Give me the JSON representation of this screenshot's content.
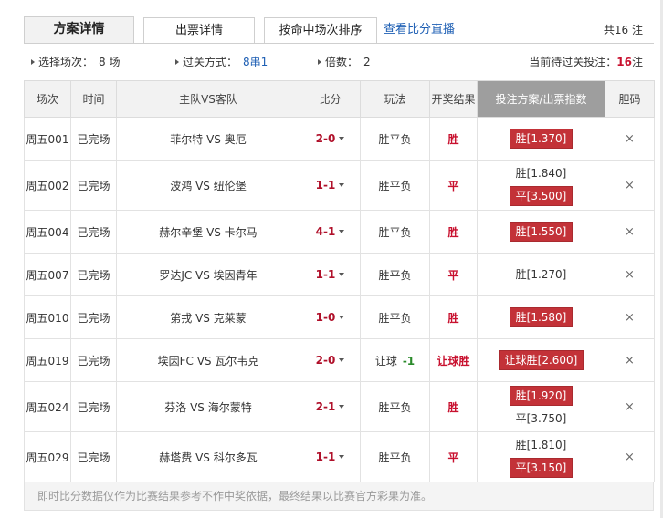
{
  "tabs": {
    "detail": "方案详情",
    "ticket": "出票详情",
    "sort": "按命中场次排序",
    "live_link": "查看比分直播",
    "total": "共16 注"
  },
  "info": {
    "select_label": "选择场次：",
    "select_value": "8 场",
    "pass_label": "过关方式：",
    "pass_value": "8串1",
    "multi_label": "倍数：",
    "multi_value": "2",
    "pending_label": "当前待过关投注：",
    "pending_value": "16",
    "pending_unit": "注"
  },
  "headers": {
    "match": "场次",
    "time": "时间",
    "teams": "主队VS客队",
    "score": "比分",
    "play": "玩法",
    "result": "开奖结果",
    "scheme": "投注方案/出票指数",
    "banker": "胆码"
  },
  "rows": [
    {
      "match": "周五001",
      "time": "已完场",
      "teams": "菲尔特 VS 奥厄",
      "score": "2-0",
      "play": "胜平负",
      "handicap": "",
      "result": "胜",
      "picks": [
        {
          "text": "胜[1.370]",
          "hit": true
        }
      ],
      "banker": "×"
    },
    {
      "match": "周五002",
      "time": "已完场",
      "teams": "波鸿 VS 纽伦堡",
      "score": "1-1",
      "play": "胜平负",
      "handicap": "",
      "result": "平",
      "picks": [
        {
          "text": "胜[1.840]",
          "hit": false
        },
        {
          "text": "平[3.500]",
          "hit": true
        }
      ],
      "banker": "×"
    },
    {
      "match": "周五004",
      "time": "已完场",
      "teams": "赫尔辛堡 VS 卡尔马",
      "score": "4-1",
      "play": "胜平负",
      "handicap": "",
      "result": "胜",
      "picks": [
        {
          "text": "胜[1.550]",
          "hit": true
        }
      ],
      "banker": "×"
    },
    {
      "match": "周五007",
      "time": "已完场",
      "teams": "罗达JC VS 埃因青年",
      "score": "1-1",
      "play": "胜平负",
      "handicap": "",
      "result": "平",
      "picks": [
        {
          "text": "胜[1.270]",
          "hit": false
        }
      ],
      "banker": "×"
    },
    {
      "match": "周五010",
      "time": "已完场",
      "teams": "第戎 VS 克莱蒙",
      "score": "1-0",
      "play": "胜平负",
      "handicap": "",
      "result": "胜",
      "picks": [
        {
          "text": "胜[1.580]",
          "hit": true
        }
      ],
      "banker": "×"
    },
    {
      "match": "周五019",
      "time": "已完场",
      "teams": "埃因FC VS 瓦尔韦克",
      "score": "2-0",
      "play": "让球",
      "handicap": "-1",
      "result": "让球胜",
      "picks": [
        {
          "text": "让球胜[2.600]",
          "hit": true
        }
      ],
      "banker": "×"
    },
    {
      "match": "周五024",
      "time": "已完场",
      "teams": "芬洛 VS 海尔蒙特",
      "score": "2-1",
      "play": "胜平负",
      "handicap": "",
      "result": "胜",
      "picks": [
        {
          "text": "胜[1.920]",
          "hit": true
        },
        {
          "text": "平[3.750]",
          "hit": false
        }
      ],
      "banker": "×"
    },
    {
      "match": "周五029",
      "time": "已完场",
      "teams": "赫塔费 VS 科尔多瓦",
      "score": "1-1",
      "play": "胜平负",
      "handicap": "",
      "result": "平",
      "picks": [
        {
          "text": "胜[1.810]",
          "hit": false
        },
        {
          "text": "平[3.150]",
          "hit": true
        }
      ],
      "banker": "×"
    }
  ],
  "note": "即时比分数据仅作为比赛结果参考不作中奖依据，最终结果以比赛官方彩果为准。",
  "colors": {
    "accent": "#c33238",
    "link": "#1e5fb4",
    "header_gray": "#9e9e9e"
  }
}
